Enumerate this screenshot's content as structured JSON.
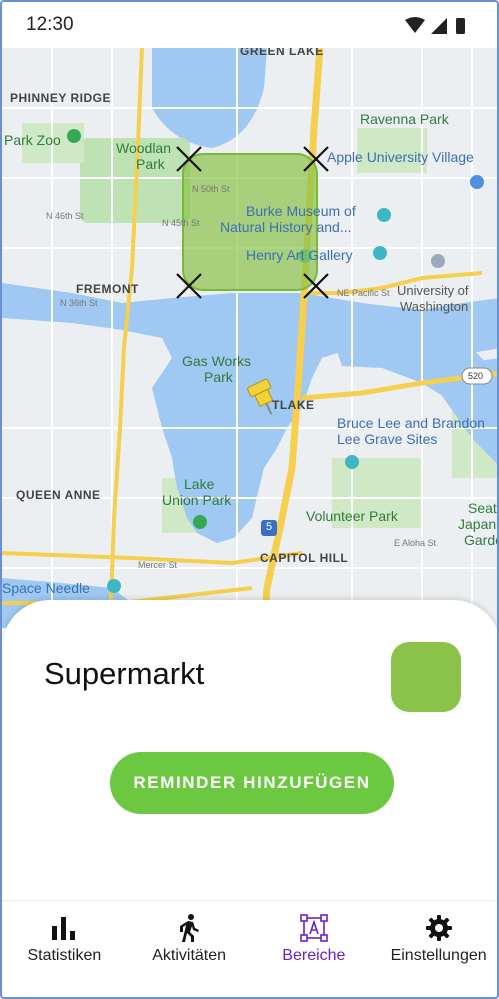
{
  "status_bar": {
    "time": "12:30",
    "icons": [
      "wifi-icon",
      "signal-icon",
      "battery-icon"
    ]
  },
  "map": {
    "labels": {
      "green_lake": "GREEN LAKE",
      "phinney_ridge": "PHINNEY RIDGE",
      "ravenna_park": "Ravenna Park",
      "park_zoo": "Park Zoo",
      "woodland_1": "Woodlan",
      "woodland_2": "Park",
      "u_village": "Apple University Village",
      "burke_1": "Burke Museum of",
      "burke_2": "Natural History and...",
      "henry": "Henry Art Gallery",
      "fremont": "FREMONT",
      "uw_1": "University of",
      "uw_2": "Washington",
      "gas_works_1": "Gas Works",
      "gas_works_2": "Park",
      "eastlake": "TLAKE",
      "bruce_lee_1": "Bruce Lee and Brandon",
      "bruce_lee_2": "Lee Grave Sites",
      "queen_anne": "QUEEN ANNE",
      "lake_union_1": "Lake",
      "lake_union_2": "Union Park",
      "volunteer": "Volunteer Park",
      "seattle_1": "Seatt",
      "seattle_2": "Japan",
      "seattle_3": "Garde",
      "capitol_hill": "CAPITOL HILL",
      "space_needle": "Space Needle",
      "hwy_520": "520",
      "hwy_5": "5",
      "st_50": "N 50th St",
      "st_46": "N 46th St",
      "st_45": "N 45th St",
      "st_36": "N 36th St",
      "pacific": "NE Pacific St",
      "mercer": "Mercer St",
      "aloha": "E Aloha St"
    },
    "area_color": "#8bc34a"
  },
  "sheet": {
    "area_name": "Supermarkt",
    "swatch_color": "#8bc34a",
    "add_reminder_label": "REMINDER HINZUFÜGEN"
  },
  "bottom_nav": {
    "items": [
      {
        "label": "Statistiken",
        "icon": "bar-chart-icon"
      },
      {
        "label": "Aktivitäten",
        "icon": "walking-icon"
      },
      {
        "label": "Bereiche",
        "icon": "area-select-icon",
        "active": true
      },
      {
        "label": "Einstellungen",
        "icon": "gear-icon"
      }
    ],
    "active_color": "#6a1fd1"
  }
}
